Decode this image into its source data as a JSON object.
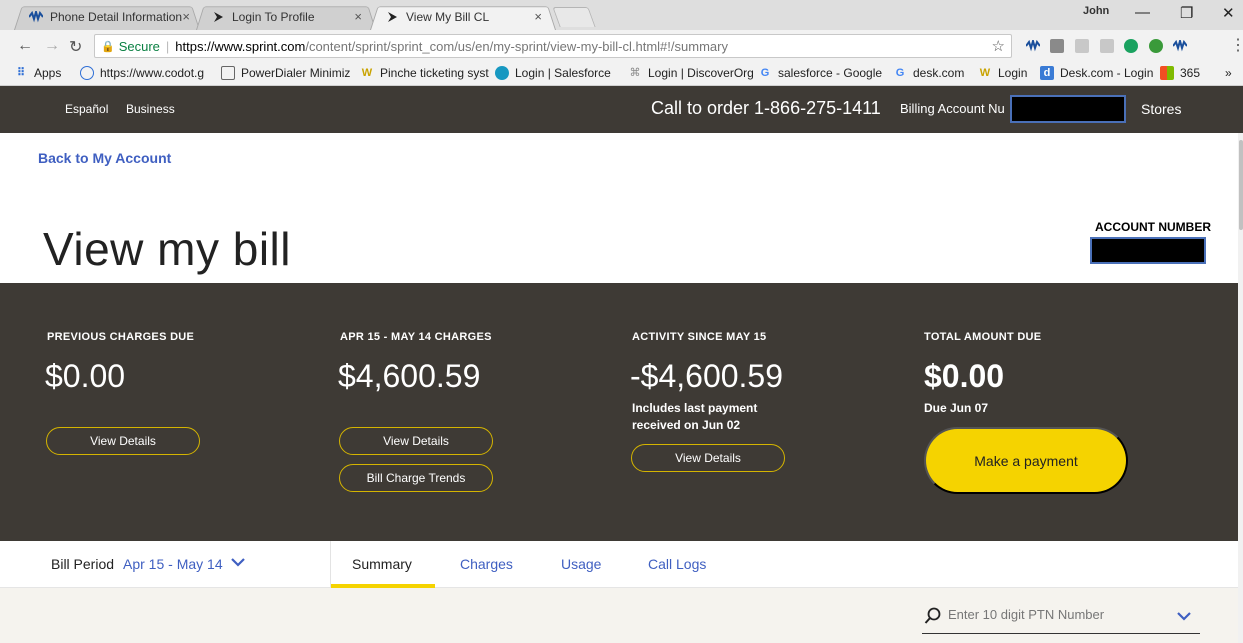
{
  "browser": {
    "tabs": [
      {
        "title": "Phone Detail Information",
        "icon": "sprint-logo-icon"
      },
      {
        "title": "Login To Profile",
        "icon": "sprint-arrow-icon"
      },
      {
        "title": "View My Bill CL",
        "icon": "sprint-arrow-icon"
      }
    ],
    "profile_name": "John",
    "window_controls": {
      "minimize": "—",
      "restore": "❐",
      "close": "✕"
    },
    "secure_label": "Secure",
    "url_host": "https://www.sprint.com",
    "url_path": "/content/sprint/sprint_com/us/en/my-sprint/view-my-bill-cl.html#!/summary",
    "bookmarks": [
      "Apps",
      "https://www.codot.g",
      "PowerDialer Minimiz",
      "Pinche ticketing syst",
      "Login | Salesforce",
      "Login | DiscoverOrg",
      "salesforce - Google",
      "desk.com",
      "Login",
      "Desk.com - Login",
      "365"
    ],
    "bookmarks_overflow": "»"
  },
  "header": {
    "links": [
      "Español",
      "Business"
    ],
    "call_to_order": "Call to order 1-866-275-1411",
    "billing_account_label": "Billing Account Nu",
    "stores": "Stores"
  },
  "page": {
    "back_link": "Back to My Account",
    "title": "View my bill",
    "account_number_label": "ACCOUNT NUMBER"
  },
  "summary": {
    "previous": {
      "label": "PREVIOUS CHARGES DUE",
      "amount": "$0.00",
      "button": "View Details"
    },
    "current": {
      "label": "APR 15 - MAY 14 CHARGES",
      "amount": "$4,600.59",
      "button": "View Details",
      "button2": "Bill Charge Trends"
    },
    "activity": {
      "label": "ACTIVITY SINCE MAY 15",
      "amount": "-$4,600.59",
      "note_line1": "Includes last payment",
      "note_line2": "received on Jun 02",
      "button": "View Details"
    },
    "total": {
      "label": "TOTAL AMOUNT DUE",
      "amount": "$0.00",
      "due": "Due Jun 07",
      "button": "Make a payment"
    }
  },
  "subnav": {
    "bill_period_label": "Bill Period",
    "bill_period_value": "Apr 15 - May 14",
    "tabs": [
      "Summary",
      "Charges",
      "Usage",
      "Call Logs"
    ],
    "active_tab": "Summary"
  },
  "filter": {
    "search_placeholder": "Enter 10 digit PTN Number"
  },
  "colors": {
    "band": "#3e3a35",
    "accent_yellow": "#f5d300",
    "link_blue": "#3f5fc1"
  }
}
